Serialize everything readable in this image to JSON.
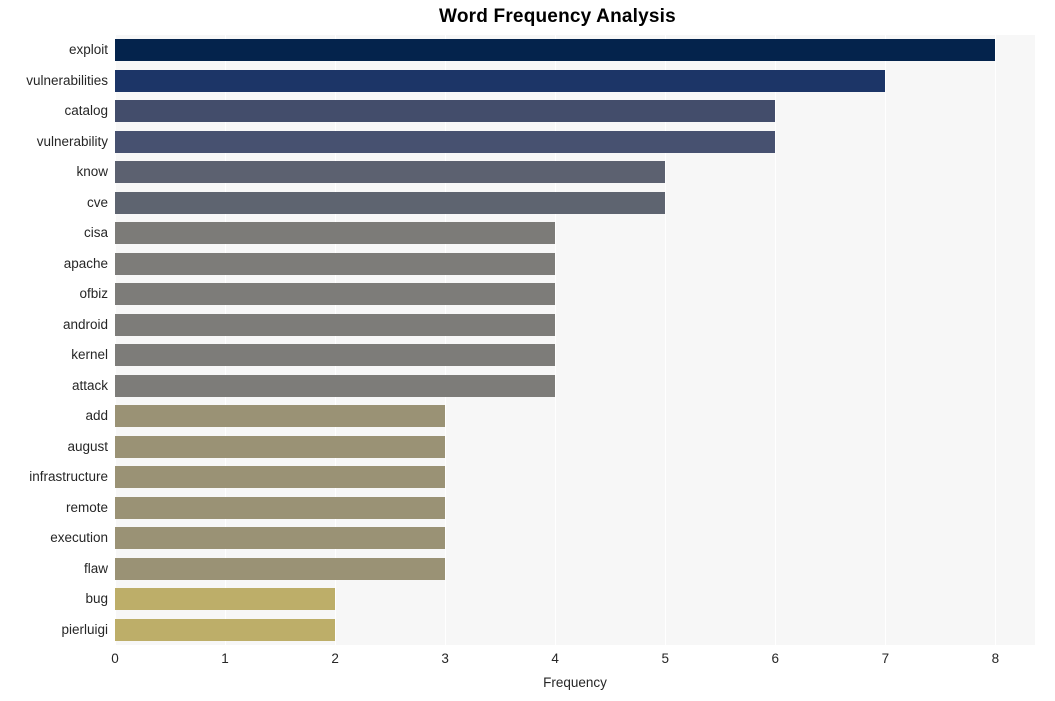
{
  "chart_data": {
    "type": "bar",
    "orientation": "horizontal",
    "title": "Word Frequency Analysis",
    "xlabel": "Frequency",
    "ylabel": "",
    "xlim": [
      0,
      8.36
    ],
    "xticks": [
      0,
      1,
      2,
      3,
      4,
      5,
      6,
      7,
      8
    ],
    "xticklabels": [
      "0",
      "1",
      "2",
      "3",
      "4",
      "5",
      "6",
      "7",
      "8"
    ],
    "grid": true,
    "grid_axis": "x",
    "grid_color": "#ffffff",
    "plot_background": "#f7f7f7",
    "figure_background": "#ffffff",
    "legend": null,
    "categories": [
      "exploit",
      "vulnerabilities",
      "catalog",
      "vulnerability",
      "know",
      "cve",
      "cisa",
      "apache",
      "ofbiz",
      "android",
      "kernel",
      "attack",
      "add",
      "august",
      "infrastructure",
      "remote",
      "execution",
      "flaw",
      "bug",
      "pierluigi"
    ],
    "values": [
      8,
      7,
      6,
      6,
      5,
      5,
      4,
      4,
      4,
      4,
      4,
      4,
      3,
      3,
      3,
      3,
      3,
      3,
      2,
      2
    ],
    "bar_colors": [
      "#04234c",
      "#1c3567",
      "#434d6b",
      "#475170",
      "#5c6170",
      "#5e6470",
      "#7c7b78",
      "#7d7c79",
      "#7d7c79",
      "#7d7c79",
      "#7d7c79",
      "#7d7c79",
      "#9a9275",
      "#9a9275",
      "#9a9275",
      "#9a9275",
      "#9a9275",
      "#9a9275",
      "#bdae69",
      "#bdae69"
    ]
  }
}
